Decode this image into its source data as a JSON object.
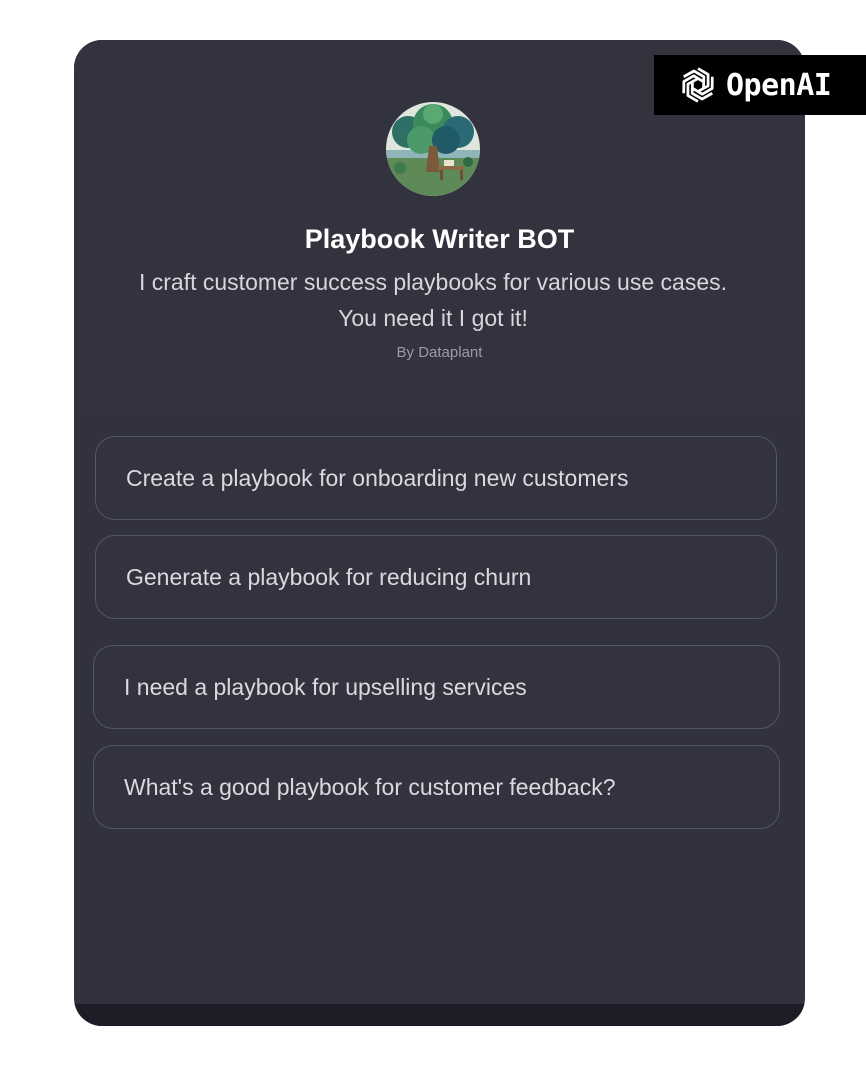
{
  "brand": {
    "name": "OpenAI",
    "icon": "openai-logo-icon"
  },
  "gpt": {
    "avatar_icon": "tree-workspace-avatar",
    "name": "Playbook Writer BOT",
    "description": "I craft customer success playbooks for various use cases. You need it I got it!",
    "author": "By Dataplant"
  },
  "prompts": [
    "Create a playbook for onboarding new customers",
    "Generate a playbook for reducing churn",
    "I need a playbook for upselling services",
    "What's a good playbook for customer feedback?"
  ],
  "colors": {
    "card_background": "#32323e",
    "prompt_border": "#55556a",
    "badge_background": "#000000"
  }
}
